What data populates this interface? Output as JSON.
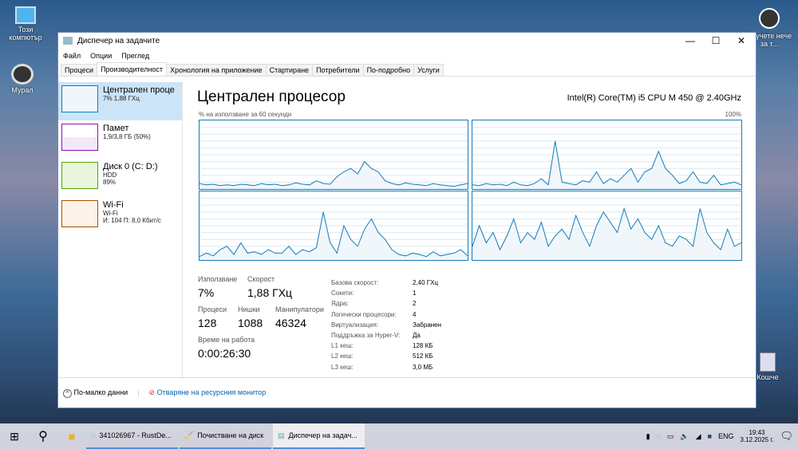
{
  "desktop": {
    "icons": [
      "Този компютър",
      "Мурал",
      "Научете нече за т...",
      "Кошче"
    ]
  },
  "window": {
    "title": "Диспечер на задачите",
    "menu": [
      "Файл",
      "Опции",
      "Преглед"
    ],
    "tabs": [
      "Процеси",
      "Производителност",
      "Хронология на приложение",
      "Стартиране",
      "Потребители",
      "По-подробно",
      "Услуги"
    ]
  },
  "sidebar": [
    {
      "name": "Централен проце",
      "sub1": "7% 1,88 ГХц",
      "sub2": ""
    },
    {
      "name": "Памет",
      "sub1": "1,9/3,8 ГБ (50%)",
      "sub2": ""
    },
    {
      "name": "Диск 0 (C: D:)",
      "sub1": "HDD",
      "sub2": "89%"
    },
    {
      "name": "Wi-Fi",
      "sub1": "Wi-Fi",
      "sub2": "И: 104 П: 8,0 Кбит/с"
    }
  ],
  "main": {
    "title": "Централен процесор",
    "model": "Intel(R) Core(TM) i5 CPU M 450 @ 2.40GHz",
    "axis_left": "% на използване за 60 секунди",
    "axis_right": "100%",
    "stats": {
      "usage_label": "Използване",
      "usage": "7%",
      "speed_label": "Скорост",
      "speed": "1,88 ГХц",
      "proc_label": "Процеси",
      "proc": "128",
      "threads_label": "Нишки",
      "threads": "1088",
      "handles_label": "Манипулатори",
      "handles": "46324",
      "uptime_label": "Време на работа",
      "uptime": "0:00:26:30"
    },
    "props": [
      [
        "Базова скорост:",
        "2,40 ГХц"
      ],
      [
        "Сокети:",
        "1"
      ],
      [
        "Ядра:",
        "2"
      ],
      [
        "Логически процесори:",
        "4"
      ],
      [
        "Виртуализация:",
        "Забранен"
      ],
      [
        "Поддръжка за Hyper-V:",
        "Да"
      ],
      [
        "L1 кеш:",
        "128 КБ"
      ],
      [
        "L2 кеш:",
        "512 КБ"
      ],
      [
        "L3 кеш:",
        "3,0 МБ"
      ]
    ]
  },
  "chart_data": {
    "type": "line",
    "ylim": [
      0,
      100
    ],
    "series": [
      {
        "name": "cpu0",
        "values": [
          8,
          6,
          7,
          5,
          6,
          5,
          7,
          6,
          5,
          8,
          6,
          7,
          5,
          6,
          9,
          7,
          6,
          12,
          8,
          7,
          18,
          25,
          30,
          22,
          40,
          30,
          25,
          12,
          8,
          6,
          9,
          7,
          6,
          5,
          8,
          6,
          5,
          4,
          6,
          8
        ]
      },
      {
        "name": "cpu1",
        "values": [
          6,
          5,
          8,
          6,
          7,
          5,
          10,
          6,
          5,
          8,
          15,
          6,
          70,
          10,
          8,
          6,
          12,
          10,
          25,
          8,
          15,
          10,
          20,
          30,
          10,
          25,
          30,
          55,
          30,
          20,
          8,
          12,
          25,
          10,
          8,
          20,
          6,
          8,
          10,
          6
        ]
      },
      {
        "name": "cpu2",
        "values": [
          5,
          10,
          6,
          15,
          20,
          8,
          25,
          10,
          12,
          8,
          15,
          10,
          10,
          20,
          8,
          15,
          12,
          18,
          70,
          25,
          10,
          50,
          30,
          20,
          45,
          60,
          40,
          30,
          15,
          8,
          6,
          10,
          8,
          5,
          12,
          6,
          8,
          10,
          15,
          6
        ]
      },
      {
        "name": "cpu3",
        "values": [
          20,
          50,
          25,
          40,
          15,
          35,
          60,
          25,
          40,
          30,
          55,
          20,
          35,
          45,
          30,
          65,
          40,
          20,
          50,
          70,
          55,
          40,
          75,
          45,
          60,
          40,
          30,
          50,
          25,
          20,
          35,
          30,
          20,
          75,
          40,
          25,
          15,
          45,
          20,
          25
        ]
      }
    ]
  },
  "footer": {
    "less": "По-малко данни",
    "monitor": "Отваряне на ресурсния монитор"
  },
  "taskbar": {
    "apps": [
      "341026967 - RustDe...",
      "Почистване на диск",
      "Диспечер на задач..."
    ],
    "lang": "ENG",
    "time": "19:43",
    "date": "3.12.2025 г."
  }
}
